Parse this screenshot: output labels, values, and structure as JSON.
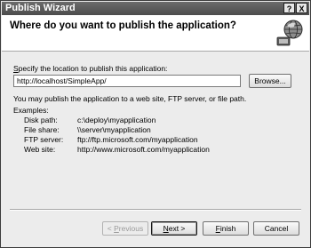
{
  "window": {
    "title": "Publish Wizard"
  },
  "titlebar_buttons": {
    "help": "?",
    "close": "X"
  },
  "header": {
    "heading": "Where do you want to publish the application?"
  },
  "location": {
    "label_prefix": "S",
    "label_rest": "pecify the location to publish this application:",
    "value": "http://localhost/SimpleApp/",
    "browse_label": "Browse..."
  },
  "info_text": "You may publish the application to a web site, FTP server, or file path.",
  "examples": {
    "title": "Examples:",
    "rows": [
      {
        "label": "Disk path:",
        "value": "c:\\deploy\\myapplication"
      },
      {
        "label": "File share:",
        "value": "\\\\server\\myapplication"
      },
      {
        "label": "FTP server:",
        "value": "ftp://ftp.microsoft.com/myapplication"
      },
      {
        "label": "Web site:",
        "value": "http://www.microsoft.com/myapplication"
      }
    ]
  },
  "buttons": {
    "previous": {
      "prefix": "< ",
      "underline": "P",
      "rest": "revious"
    },
    "next": {
      "underline": "N",
      "rest": "ext >"
    },
    "finish": {
      "underline": "F",
      "rest": "inish"
    },
    "cancel": "Cancel"
  }
}
